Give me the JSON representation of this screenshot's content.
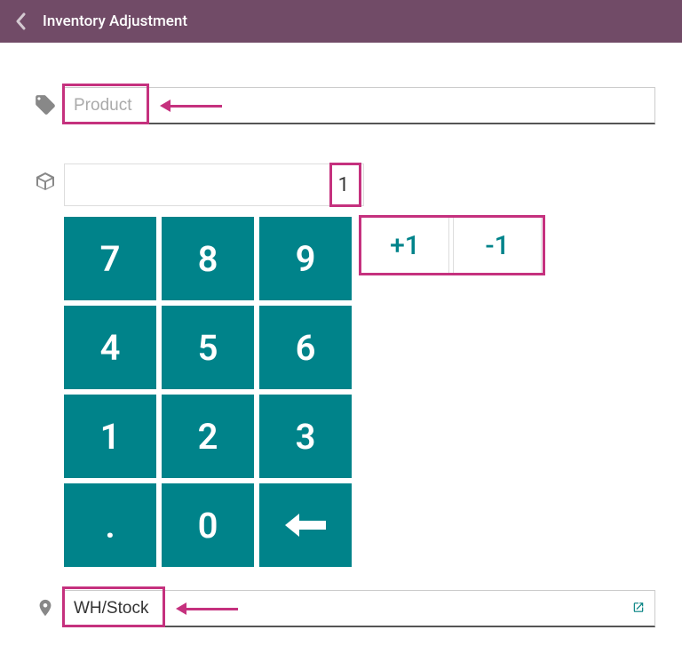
{
  "header": {
    "title": "Inventory Adjustment"
  },
  "product": {
    "placeholder": "Product",
    "value": ""
  },
  "quantity": {
    "display": "1"
  },
  "keypad": {
    "keys": [
      "7",
      "8",
      "9",
      "4",
      "5",
      "6",
      "1",
      "2",
      "3",
      ".",
      "0",
      "←"
    ],
    "plus": "+1",
    "minus": "-1"
  },
  "location": {
    "value": "WH/Stock"
  }
}
